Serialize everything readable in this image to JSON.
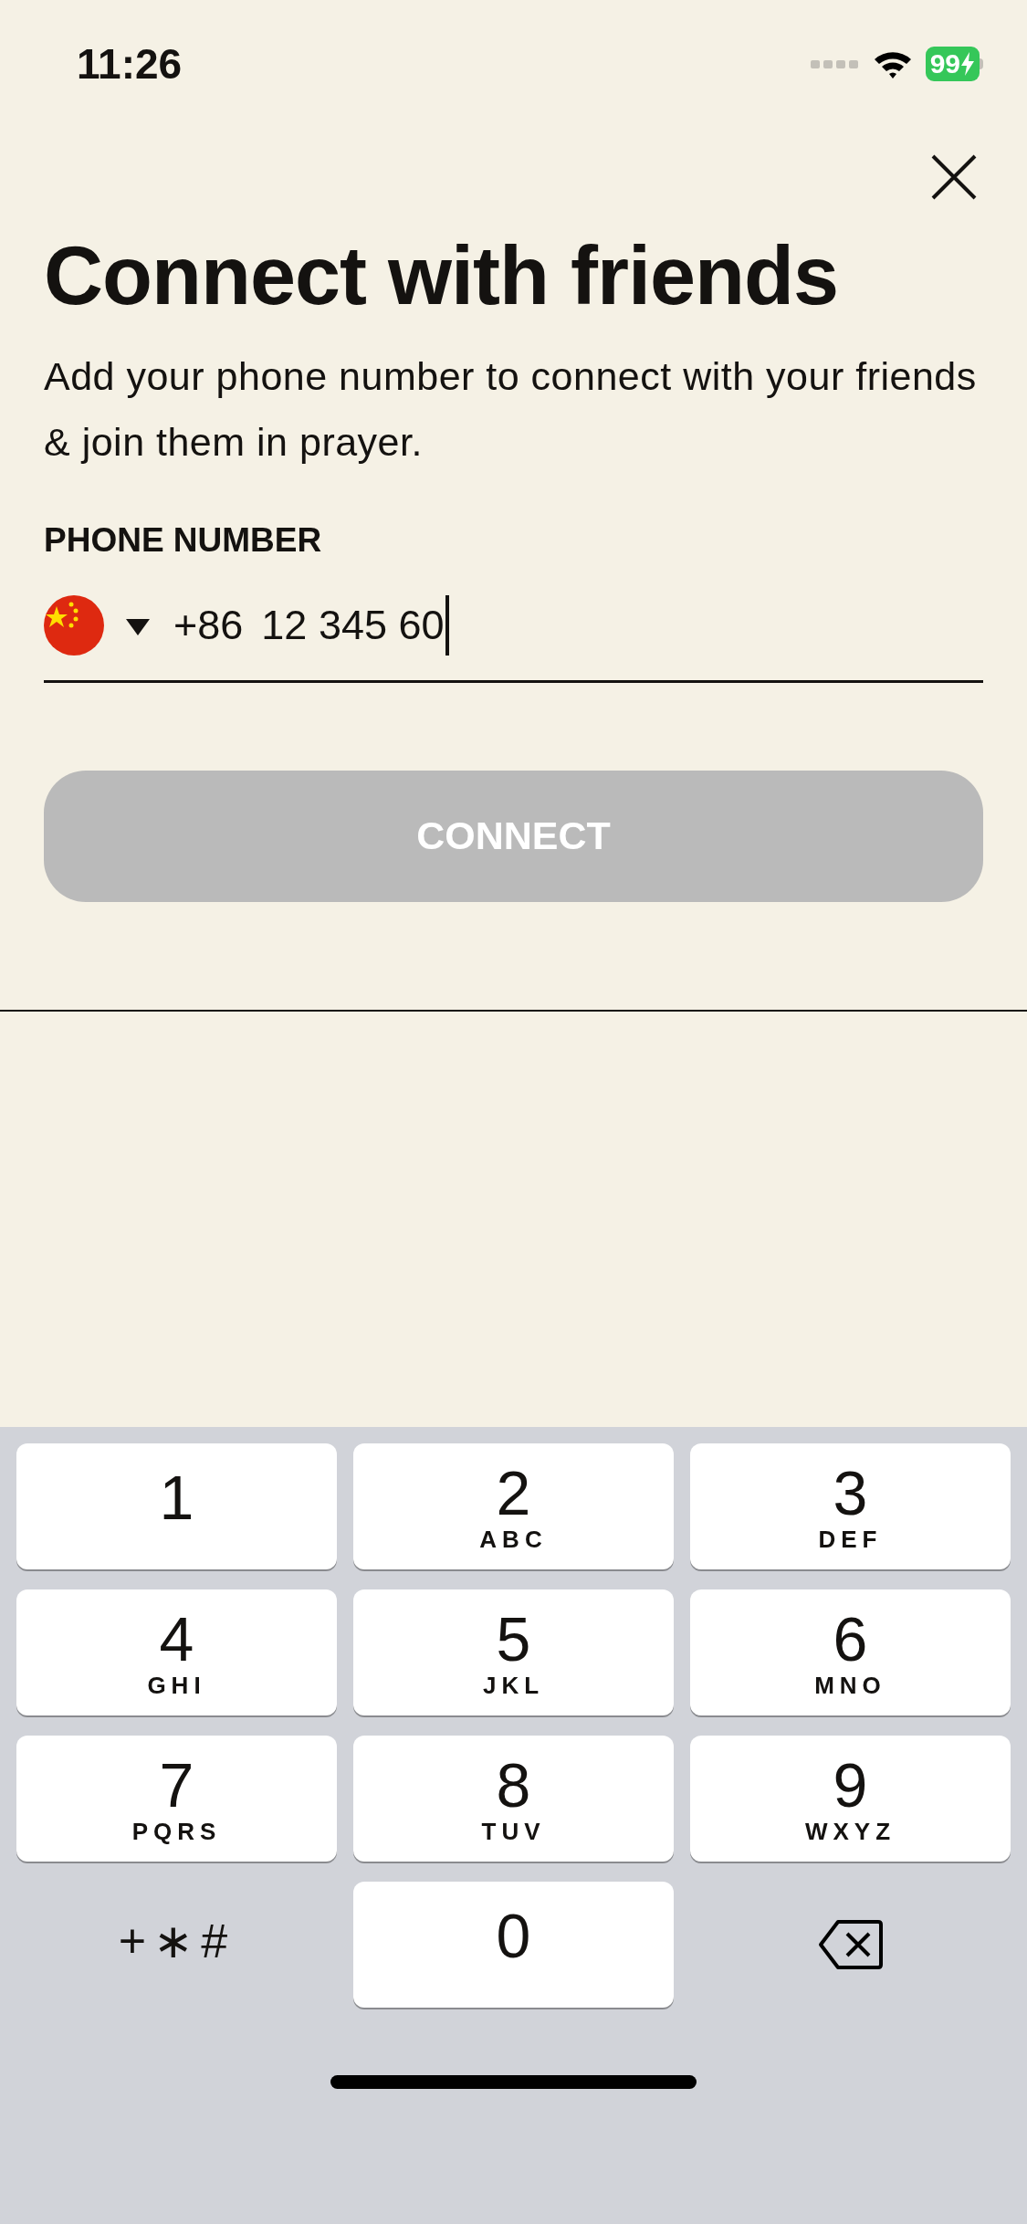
{
  "status_bar": {
    "time": "11:26",
    "battery": "99"
  },
  "title": "Connect with friends",
  "subtitle": "Add your phone number to connect with your friends & join them in prayer.",
  "phone": {
    "label": "PHONE NUMBER",
    "country_code": "+86",
    "value": "12 345 60"
  },
  "connect_button": {
    "label": "CONNECT",
    "disabled": true
  },
  "keypad": [
    {
      "kind": "digit",
      "digit": "1"
    },
    {
      "kind": "digit",
      "digit": "2",
      "letters": "ABC"
    },
    {
      "kind": "digit",
      "digit": "3",
      "letters": "DEF"
    },
    {
      "kind": "digit",
      "digit": "4",
      "letters": "GHI"
    },
    {
      "kind": "digit",
      "digit": "5",
      "letters": "JKL"
    },
    {
      "kind": "digit",
      "digit": "6",
      "letters": "MNO"
    },
    {
      "kind": "digit",
      "digit": "7",
      "letters": "PQRS"
    },
    {
      "kind": "digit",
      "digit": "8",
      "letters": "TUV"
    },
    {
      "kind": "digit",
      "digit": "9",
      "letters": "WXYZ"
    },
    {
      "kind": "symbols",
      "label": "+∗#"
    },
    {
      "kind": "digit",
      "digit": "0"
    },
    {
      "kind": "delete"
    }
  ]
}
